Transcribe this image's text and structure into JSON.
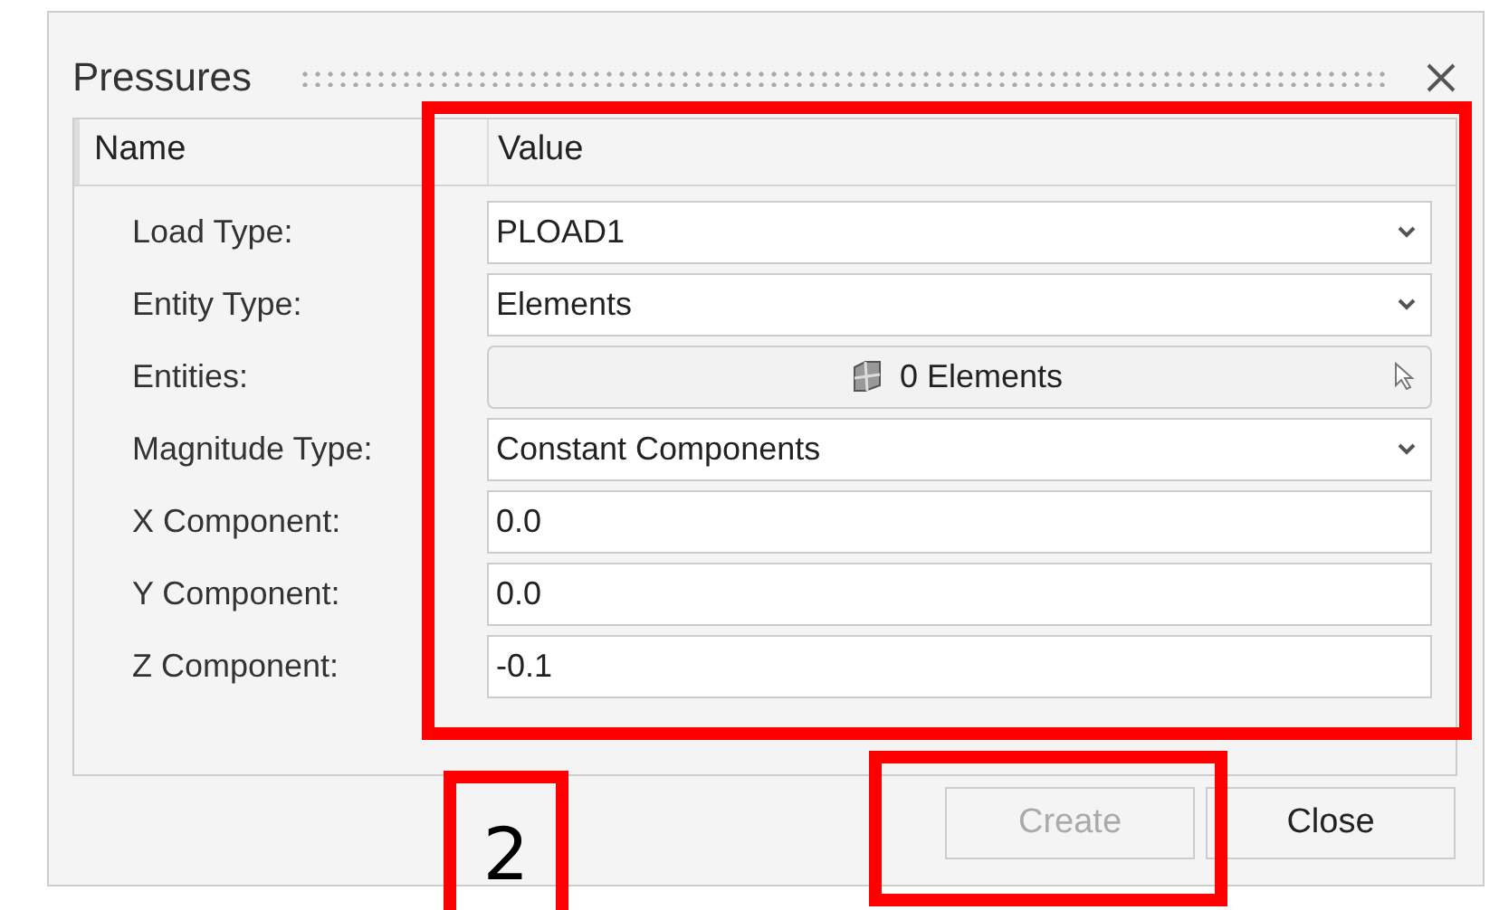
{
  "dialog": {
    "title": "Pressures"
  },
  "table": {
    "columns": [
      "Name",
      "Value"
    ],
    "rows": [
      {
        "label": "Load Type:",
        "kind": "dropdown",
        "value": "PLOAD1"
      },
      {
        "label": "Entity Type:",
        "kind": "dropdown",
        "value": "Elements"
      },
      {
        "label": "Entities:",
        "kind": "picker",
        "value": "0 Elements"
      },
      {
        "label": "Magnitude Type:",
        "kind": "dropdown",
        "value": "Constant Components"
      },
      {
        "label": "X Component:",
        "kind": "text",
        "value": "0.0"
      },
      {
        "label": "Y Component:",
        "kind": "text",
        "value": "0.0"
      },
      {
        "label": "Z Component:",
        "kind": "text",
        "value": "-0.1"
      }
    ]
  },
  "buttons": [
    {
      "label": "Create",
      "disabled": true
    },
    {
      "label": "Close",
      "disabled": false
    }
  ],
  "annotations": [
    {
      "kind": "frame"
    },
    {
      "kind": "frame"
    },
    {
      "kind": "callout",
      "text": "2"
    }
  ]
}
